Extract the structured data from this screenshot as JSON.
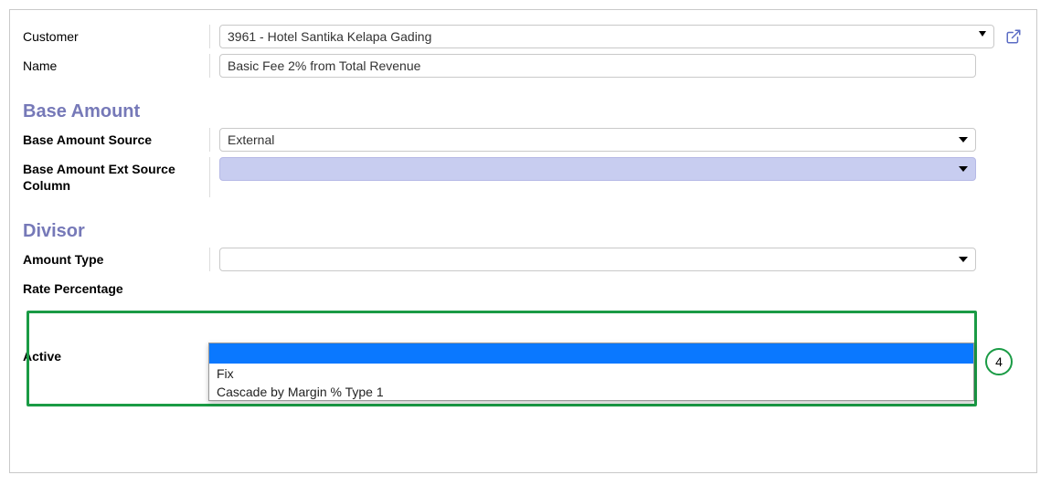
{
  "customer": {
    "label": "Customer",
    "value": "3961 - Hotel Santika Kelapa Gading"
  },
  "name": {
    "label": "Name",
    "value": "Basic Fee 2% from Total Revenue"
  },
  "base_amount": {
    "title": "Base Amount",
    "source_label": "Base Amount Source",
    "source_value": "External",
    "ext_col_label": "Base Amount Ext Source Column",
    "ext_col_value": ""
  },
  "divisor": {
    "title": "Divisor",
    "amount_type_label": "Amount Type",
    "amount_type_value": "",
    "rate_label": "Rate Percentage",
    "options": {
      "blank": "",
      "fix": "Fix",
      "cascade": "Cascade by Margin % Type 1"
    }
  },
  "active": {
    "label": "Active",
    "checked": true
  },
  "callout": {
    "number": "4"
  }
}
